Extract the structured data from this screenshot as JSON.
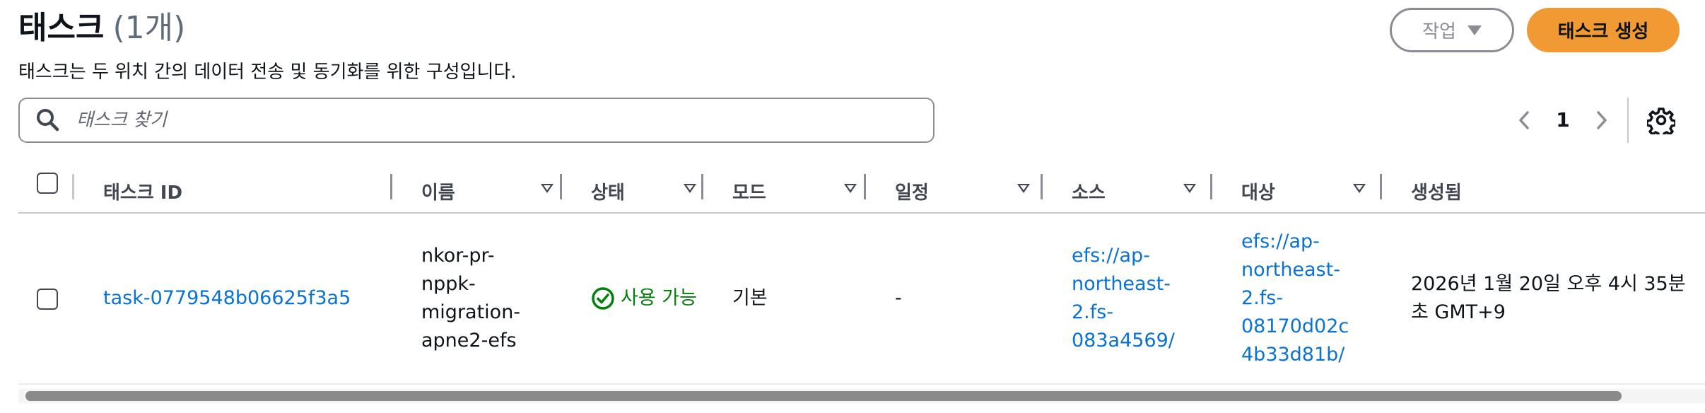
{
  "header": {
    "title": "태스크",
    "count": "(1개)",
    "description": "태스크는 두 위치 간의 데이터 전송 및 동기화를 위한 구성입니다.",
    "actions_label": "작업",
    "create_label": "태스크 생성"
  },
  "search": {
    "placeholder": "태스크 찾기",
    "value": ""
  },
  "pagination": {
    "current_page": "1"
  },
  "table": {
    "columns": [
      {
        "label": "태스크 ID",
        "sortable": false
      },
      {
        "label": "이름",
        "sortable": true
      },
      {
        "label": "상태",
        "sortable": true
      },
      {
        "label": "모드",
        "sortable": true
      },
      {
        "label": "일정",
        "sortable": true
      },
      {
        "label": "소스",
        "sortable": true
      },
      {
        "label": "대상",
        "sortable": true
      },
      {
        "label": "생성됨",
        "sortable": false
      }
    ],
    "rows": [
      {
        "task_id": "task-0779548b06625f3a5",
        "name_lines": [
          "nkor-pr-",
          "nppk-",
          "migration-",
          "apne2-efs"
        ],
        "status": "사용 가능",
        "mode": "기본",
        "schedule": "-",
        "source_lines": [
          "efs://ap-",
          "northeast-",
          "2.fs-",
          "083a4569/"
        ],
        "destination_lines": [
          "efs://ap-",
          "northeast-",
          "2.fs-",
          "08170d02c",
          "4b33d81b/"
        ],
        "created_lines": [
          "2026년 1월 20일 오후 4시 35분 ",
          "초 GMT+9"
        ]
      }
    ]
  },
  "colors": {
    "primary_button": "#f19a33",
    "link": "#0972d3",
    "success": "#037f0c"
  },
  "icons": {
    "search": "search-icon",
    "status": "success-check-icon",
    "settings": "gear-icon",
    "prev": "chevron-left-icon",
    "next": "chevron-right-icon",
    "actions_caret": "caret-down-icon"
  }
}
